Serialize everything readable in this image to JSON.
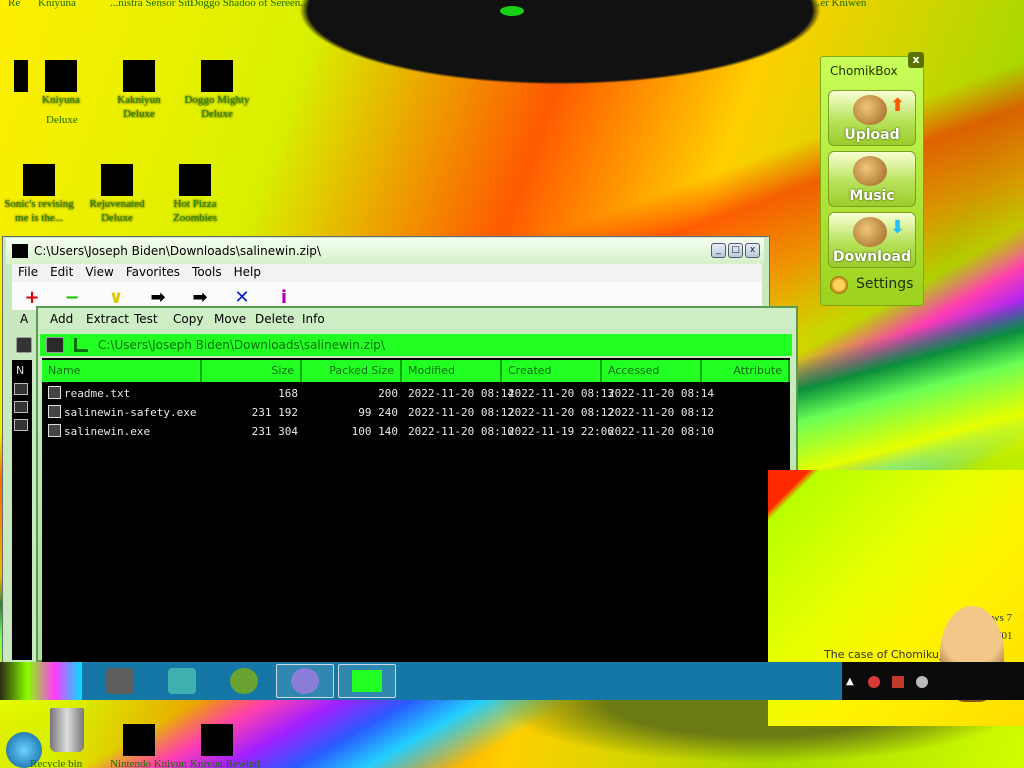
{
  "desktop": {
    "top_partial_labels": [
      "Re",
      "Kniyuna",
      "...nistra Sensor Siti",
      "Doggo Shadoo of Sereen...",
      "...er Kniwen"
    ],
    "icons_row1": [
      {
        "label": "Kniyuna",
        "label2": "Deluxe"
      },
      {
        "label": "Kakniyun",
        "label2": "Deluxe"
      },
      {
        "label": "Doggo Mighty",
        "label2": "Deluxe"
      }
    ],
    "icons_row2": [
      {
        "label": "Sonic's revising",
        "label2": "me is the..."
      },
      {
        "label": "Rejuvenated",
        "label2": "Deluxe"
      },
      {
        "label": "Hot Pizza",
        "label2": "Zoombies"
      }
    ],
    "bottom_partial_labels": [
      "Recycle bin",
      "Nintendo Kniyun",
      "Kniyun Rewind"
    ]
  },
  "archive_window": {
    "title": "C:\\Users\\Joseph Biden\\Downloads\\salinewin.zip\\",
    "controls": {
      "minimize": "_",
      "maximize": "□",
      "close": "x"
    },
    "menu": [
      "File",
      "Edit",
      "View",
      "Favorites",
      "Tools",
      "Help"
    ],
    "toolbar": [
      {
        "label": "Add",
        "icon": "plus-icon",
        "color": "#e00000",
        "glyph": "+"
      },
      {
        "label": "Extract",
        "icon": "minus-icon",
        "color": "#14c800",
        "glyph": "−"
      },
      {
        "label": "Test",
        "icon": "check-icon",
        "color": "#d9c800",
        "glyph": "∨"
      },
      {
        "label": "Copy",
        "icon": "double-arrow-icon",
        "color": "#000000",
        "glyph": "➡"
      },
      {
        "label": "Move",
        "icon": "arrow-icon",
        "color": "#000000",
        "glyph": "➡"
      },
      {
        "label": "Delete",
        "icon": "x-icon",
        "color": "#0022cc",
        "glyph": "✕"
      },
      {
        "label": "Info",
        "icon": "info-icon",
        "color": "#b000b0",
        "glyph": "i"
      }
    ],
    "toolbar_back_label": "A",
    "path": "C:\\Users\\Joseph Biden\\Downloads\\salinewin.zip\\",
    "columns": [
      "Name",
      "Size",
      "Packed Size",
      "Modified",
      "Created",
      "Accessed",
      "Attribute"
    ],
    "rows": [
      {
        "name": "readme.txt",
        "size": "168",
        "packed": "200",
        "modified": "2022-11-20 08:14",
        "created": "2022-11-20 08:13",
        "accessed": "2022-11-20 08:14"
      },
      {
        "name": "salinewin-safety.exe",
        "size": "231 192",
        "packed": "99 240",
        "modified": "2022-11-20 08:12",
        "created": "2022-11-20 08:12",
        "accessed": "2022-11-20 08:12"
      },
      {
        "name": "salinewin.exe",
        "size": "231 304",
        "packed": "100 140",
        "modified": "2022-11-20 08:10",
        "created": "2022-11-19 22:06",
        "accessed": "2022-11-20 08:10"
      }
    ],
    "left_pane_header": "N"
  },
  "chomikbox": {
    "title": "ChomikBox",
    "close": "x",
    "buttons": [
      {
        "label": "Upload",
        "arrow": "⬆",
        "arrow_color": "#ff5a00"
      },
      {
        "label": "Music",
        "arrow": "",
        "arrow_color": "#000000"
      },
      {
        "label": "Download",
        "arrow": "⬇",
        "arrow_color": "#20c0ff"
      }
    ],
    "settings_label": "Settings"
  },
  "notification": {
    "text1": "The case of Chomikuj...",
    "text2": "ows 7",
    "text3": "701"
  },
  "colors": {
    "taskbar": "#1477a6",
    "path_bar": "#22ff22",
    "list_bg": "#000000"
  }
}
